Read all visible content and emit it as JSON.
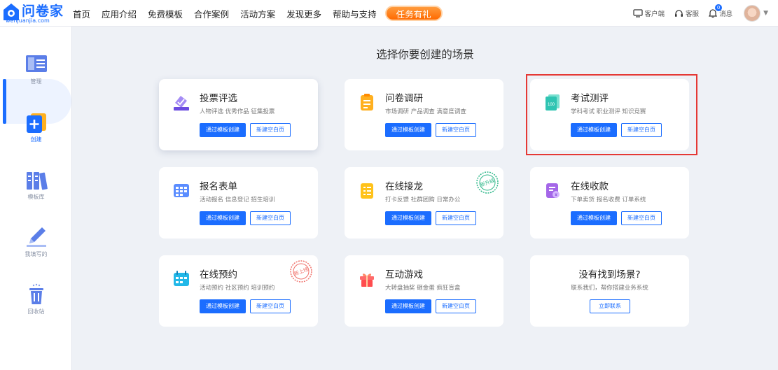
{
  "logo": {
    "name": "问卷家",
    "domain": "wenjuanjia.com"
  },
  "nav": {
    "items": [
      "首页",
      "应用介绍",
      "免费模板",
      "合作案例",
      "活动方案",
      "发现更多",
      "帮助与支持"
    ],
    "badge": "任务有礼"
  },
  "top_right": {
    "client": "客户端",
    "service": "客服",
    "messages": "消息",
    "message_count": "0"
  },
  "sidebar": {
    "items": [
      {
        "label": "管理",
        "icon": "manage-icon"
      },
      {
        "label": "创建",
        "icon": "create-icon"
      },
      {
        "label": "模板库",
        "icon": "template-library-icon"
      },
      {
        "label": "我填写的",
        "icon": "pen-icon"
      },
      {
        "label": "回收站",
        "icon": "trash-icon"
      }
    ],
    "active_index": 1
  },
  "main": {
    "heading": "选择你要创建的场景",
    "template_btn": "通过模板创建",
    "blank_btn": "新建空白页",
    "cards": [
      {
        "title": "投票评选",
        "subtitle": "人物评选 优秀作品 征集投票",
        "icon": "vote-icon"
      },
      {
        "title": "问卷调研",
        "subtitle": "市场调研 产品调查 满意度调查",
        "icon": "survey-icon"
      },
      {
        "title": "考试测评",
        "subtitle": "学科考试 职业测评 知识竞赛",
        "icon": "exam-icon"
      },
      {
        "title": "报名表单",
        "subtitle": "活动报名 信息登记 招生培训",
        "icon": "form-icon"
      },
      {
        "title": "在线接龙",
        "subtitle": "打卡反馈 社群团购 日常办公",
        "icon": "relay-icon"
      },
      {
        "title": "在线收款",
        "subtitle": "下单卖货 报名收费 订单系统",
        "icon": "payment-icon"
      },
      {
        "title": "在线预约",
        "subtitle": "活动预约 社区预约 培训预约",
        "icon": "calendar-icon"
      },
      {
        "title": "互动游戏",
        "subtitle": "大转盘抽奖 砸金蛋 疯狂盲盒",
        "icon": "gift-icon"
      }
    ],
    "stamps": {
      "relay": "新升级",
      "booking": "新上线"
    },
    "not_found": {
      "title": "没有找到场景?",
      "subtitle": "联系我们，帮你搭建业务系统",
      "button": "立即联系"
    }
  },
  "colors": {
    "primary": "#1b6dff",
    "highlight": "#e53935",
    "badge": "#ff7a1a"
  }
}
